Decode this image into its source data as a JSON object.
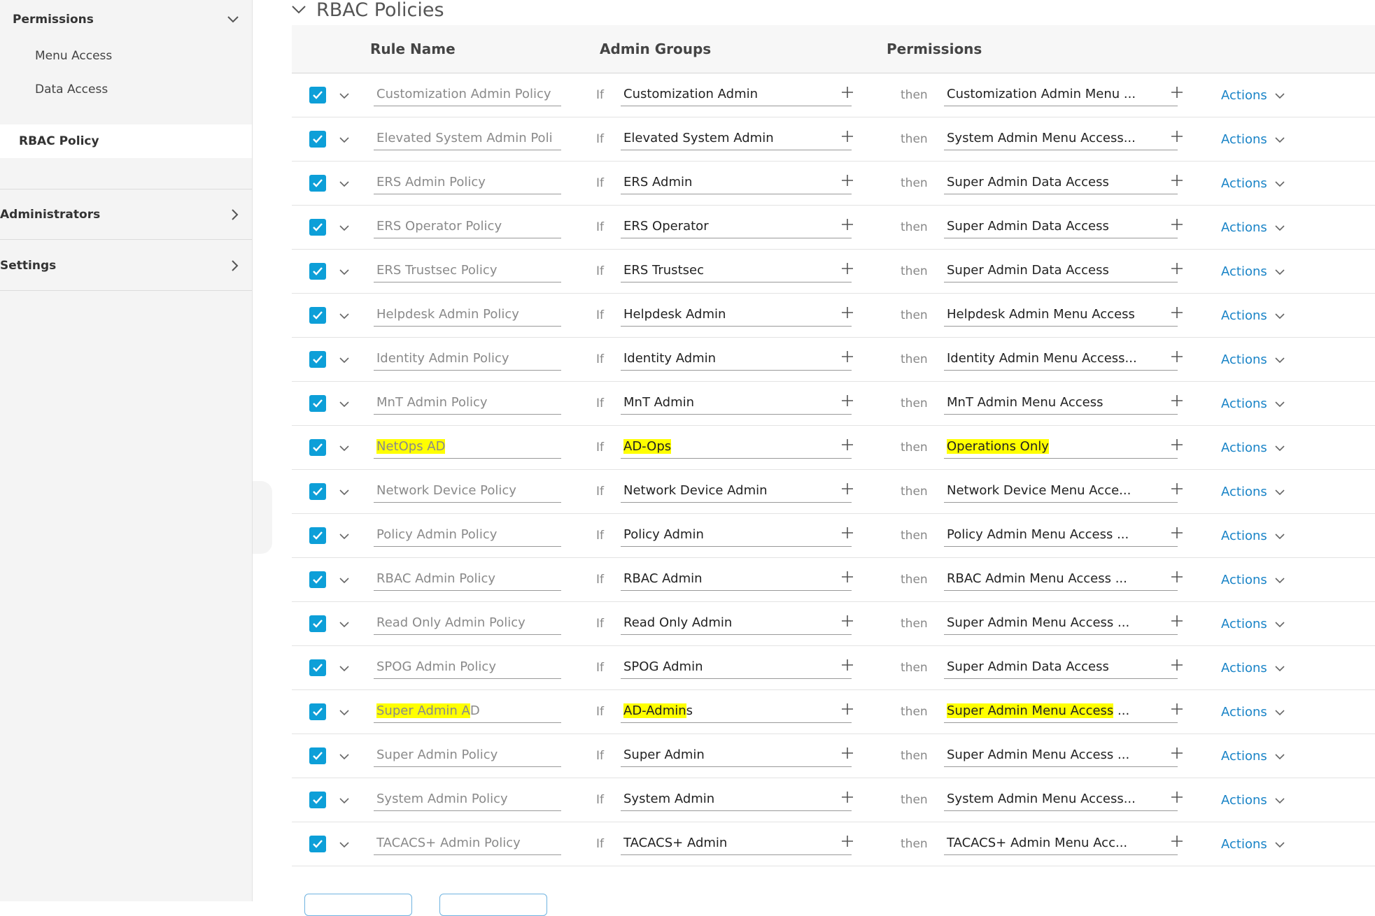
{
  "sidebar": {
    "permissions_label": "Permissions",
    "sub_items": [
      "Menu Access",
      "Data Access"
    ],
    "active_label": "RBAC Policy",
    "groups": [
      "Administrators",
      "Settings"
    ]
  },
  "section": {
    "title": "RBAC Policies"
  },
  "table": {
    "headers": {
      "rule_name": "Rule Name",
      "admin_groups": "Admin Groups",
      "permissions": "Permissions"
    },
    "if_label": "If",
    "then_label": "then",
    "actions_label": "Actions",
    "rows": [
      {
        "name": "Customization Admin Policy",
        "group": "Customization Admin",
        "perm": "Customization Admin Menu ..."
      },
      {
        "name": "Elevated System Admin Poli",
        "group": "Elevated System Admin",
        "perm": "System Admin Menu Access..."
      },
      {
        "name": "ERS Admin Policy",
        "group": "ERS Admin",
        "perm": "Super Admin Data Access"
      },
      {
        "name": "ERS Operator Policy",
        "group": "ERS Operator",
        "perm": "Super Admin Data Access"
      },
      {
        "name": "ERS Trustsec Policy",
        "group": "ERS Trustsec",
        "perm": "Super Admin Data Access"
      },
      {
        "name": "Helpdesk Admin Policy",
        "group": "Helpdesk Admin",
        "perm": "Helpdesk Admin Menu Access"
      },
      {
        "name": "Identity Admin Policy",
        "group": "Identity Admin",
        "perm": "Identity Admin Menu Access..."
      },
      {
        "name": "MnT Admin Policy",
        "group": "MnT Admin",
        "perm": "MnT Admin Menu Access"
      },
      {
        "name": "NetOps AD",
        "group": "AD-Ops",
        "perm": "Operations Only"
      },
      {
        "name": "Network Device Policy",
        "group": "Network Device Admin",
        "perm": "Network Device Menu Acce..."
      },
      {
        "name": "Policy Admin Policy",
        "group": "Policy Admin",
        "perm": "Policy Admin Menu Access ..."
      },
      {
        "name": "RBAC Admin Policy",
        "group": "RBAC Admin",
        "perm": "RBAC Admin Menu Access ..."
      },
      {
        "name": "Read Only Admin Policy",
        "group": "Read Only Admin",
        "perm": "Super Admin Menu Access ..."
      },
      {
        "name": "SPOG Admin Policy",
        "group": "SPOG Admin",
        "perm": "Super Admin Data Access"
      },
      {
        "name": "Super Admin AD",
        "group": "AD-Admins",
        "perm": "Super Admin Menu Access ..."
      },
      {
        "name": "Super Admin Policy",
        "group": "Super Admin",
        "perm": "Super Admin Menu Access ..."
      },
      {
        "name": "System Admin Policy",
        "group": "System Admin",
        "perm": "System Admin Menu Access..."
      },
      {
        "name": "TACACS+ Admin Policy",
        "group": "TACACS+ Admin",
        "perm": "TACACS+ Admin Menu Acc..."
      }
    ]
  },
  "colors": {
    "accent": "#0d9fd8",
    "link": "#1a84c7",
    "highlight": "#ffff00"
  },
  "icons": {
    "checkbox": "check-icon",
    "expand": "chevron-down-icon",
    "add": "plus-icon",
    "nav": "chevron-right-icon"
  }
}
